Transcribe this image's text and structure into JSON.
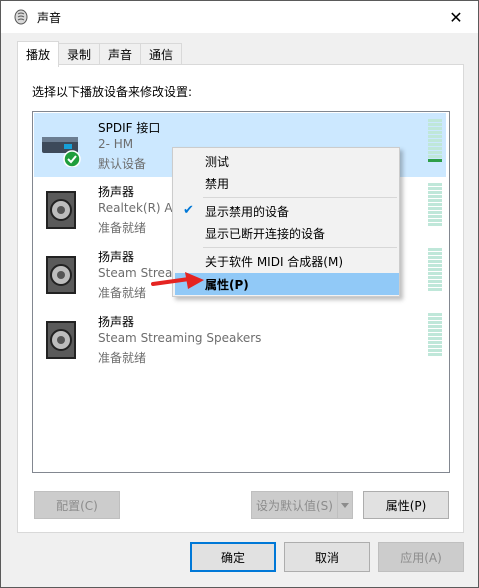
{
  "window": {
    "title": "声音",
    "close_glyph": "✕"
  },
  "tabs": [
    {
      "label": "播放"
    },
    {
      "label": "录制"
    },
    {
      "label": "声音"
    },
    {
      "label": "通信"
    }
  ],
  "instruction": "选择以下播放设备来修改设置:",
  "devices": [
    {
      "name": "SPDIF 接口",
      "desc": "2- HM",
      "status": "默认设备",
      "icon": "spdif-icon"
    },
    {
      "name": "扬声器",
      "desc": "Realtek(R) A",
      "status": "准备就绪",
      "icon": "speaker-icon"
    },
    {
      "name": "扬声器",
      "desc": "Steam Strea",
      "status": "准备就绪",
      "icon": "speaker-icon"
    },
    {
      "name": "扬声器",
      "desc": "Steam Streaming Speakers",
      "status": "准备就绪",
      "icon": "speaker-icon"
    }
  ],
  "context_menu": {
    "items": [
      {
        "label": "测试"
      },
      {
        "label": "禁用"
      },
      {
        "label": "显示禁用的设备",
        "checked": true
      },
      {
        "label": "显示已断开连接的设备"
      },
      {
        "label": "关于软件 MIDI 合成器(M)"
      },
      {
        "label": "属性(P)",
        "highlighted": true
      }
    ]
  },
  "buttons": {
    "configure": "配置(C)",
    "set_default": "设为默认值(S)",
    "properties": "属性(P)",
    "ok": "确定",
    "cancel": "取消",
    "apply": "应用(A)"
  },
  "colors": {
    "selection": "#cce8ff",
    "menu_highlight": "#91c9f7",
    "accent": "#0078d7",
    "arrow": "#e52421",
    "meter_active": "#2e9e48"
  }
}
